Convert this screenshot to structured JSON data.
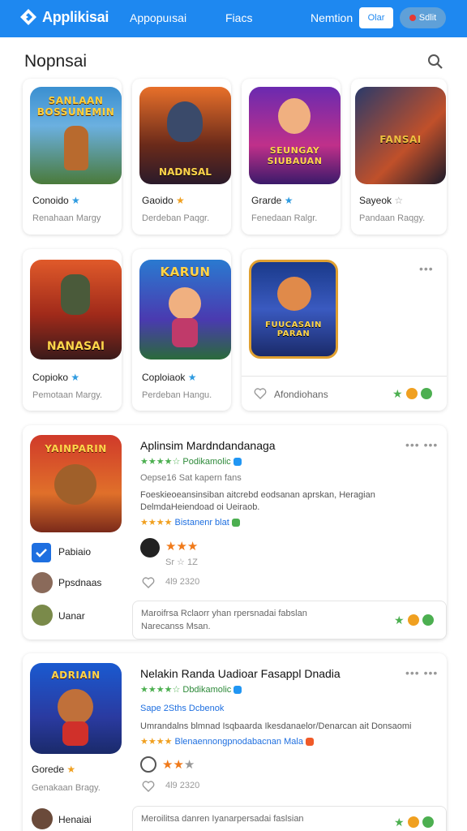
{
  "header": {
    "logo": "Applikisai",
    "nav": [
      "Appopuısai",
      "Fiacs",
      "Nemtion"
    ],
    "login_label": "Olar",
    "start_label": "Sdlit"
  },
  "page": {
    "title": "Nopnsai"
  },
  "row1": [
    {
      "title": "Conoido",
      "sub": "Renahaan Margy",
      "thumb_text": "SANLAAN BOSSUNEMIN",
      "badge": "★"
    },
    {
      "title": "Gaoido",
      "sub": "Derdeban Paqgr.",
      "thumb_text": "NADNSAL",
      "badge": "★"
    },
    {
      "title": "Grarde",
      "sub": "Fenedaan Ralgr.",
      "thumb_text": "SEUNGAY SIUBAUAN",
      "badge": "★"
    },
    {
      "title": "Sayeok",
      "sub": "Pandaan Raqgy.",
      "thumb_text": "FANSAI",
      "badge": "☆"
    }
  ],
  "row2": [
    {
      "title": "Copioko",
      "sub": "Pemotaan Margy.",
      "thumb_text": "NANASAI",
      "badge": "★"
    },
    {
      "title": "Coploiaok",
      "sub": "Perdeban Hangu.",
      "thumb_text": "KARUN",
      "badge": "★"
    }
  ],
  "row2_feature": {
    "footer_label": "Afondiohans",
    "thumb_text": "FUUCASAIN PARAN"
  },
  "list": [
    {
      "title": "Aplinsim Mardndandanaga",
      "rating_text": "Podikamolic",
      "meta": "Oepse16 Sat kapern fans",
      "desc1": "Foeskieoeansinsiban aitcrebd eodsanan aprskan, Heragian",
      "desc2": "DelmdaHeiendoad oi Ueiraob.",
      "badge_text": "Bistanenr blat",
      "side": [
        "Pabiaio",
        "Ppsdnaas",
        "Uanar"
      ],
      "side_sub": "Sr ☆ 1Z",
      "stats": "4l9   2320",
      "footer": "Maroifrsa Rclaorr yhan rpersnadai fabslan",
      "footer2": "Narecanss Msan.",
      "thumb_text": "YAINPARIN"
    },
    {
      "title": "Nelakin Randa Uadioar Fasappl Dnadia",
      "rating_text": "Dbdikamolic",
      "meta": "Sape  2Sths    Dcbenok",
      "desc1": "Umrandalns blmnad Isqbaarda Ikesdanaelor/Denarcan ait Donsaomi",
      "badge_text": "Blenaennongpnodabacnan Mala",
      "side": [
        "Gorede",
        "Henaiai"
      ],
      "side_sub": "Genakaan Bragy.",
      "stats": "4l9   2320",
      "footer": "Meroilitsa danren Iyanarpersadai faslsian",
      "thumb_text": "ADRIAIN"
    }
  ],
  "colors": {
    "accent": "#1e88f0",
    "green": "#4caf50",
    "orange": "#ff9800"
  }
}
